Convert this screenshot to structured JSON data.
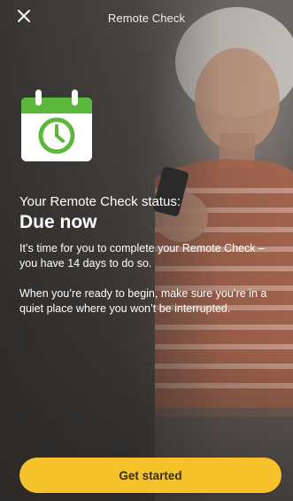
{
  "header": {
    "title": "Remote Check",
    "close_icon": "close-icon"
  },
  "status": {
    "icon": "calendar-clock-icon",
    "label": "Your Remote Check status:",
    "value": "Due now"
  },
  "body": {
    "paragraph_1": "It’s time for you to complete your Remote Check – you have 14 days to do so.",
    "paragraph_2": "When you’re ready to begin, make sure you’re in a quiet place where you won’t be interrupted."
  },
  "actions": {
    "primary_label": "Get started"
  },
  "colors": {
    "accent": "#f6c22c",
    "icon_green": "#5cb83a",
    "text": "#ffffff"
  }
}
